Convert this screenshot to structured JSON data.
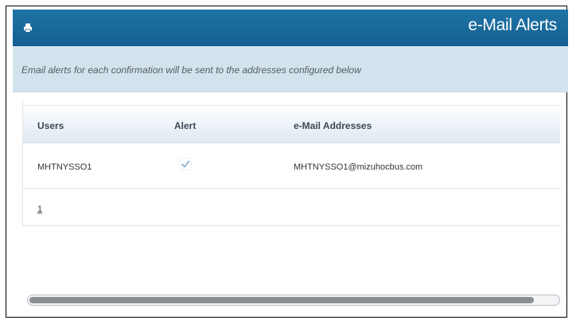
{
  "header": {
    "title": "e-Mail Alerts",
    "print_icon": "print-icon"
  },
  "info": {
    "text": "Email alerts for each confirmation will be sent to the addresses configured below"
  },
  "table": {
    "columns": [
      "Users",
      "Alert",
      "e-Mail Addresses"
    ],
    "rows": [
      {
        "user": "MHTNYSSO1",
        "alert": true,
        "email": "MHTNYSSO1@mizuhocbus.com"
      }
    ]
  },
  "pager": {
    "pages": [
      "1"
    ]
  },
  "colors": {
    "header_bg": "#1b6b9e",
    "info_bg": "#d3e3ee",
    "check": "#7ea9cf"
  }
}
